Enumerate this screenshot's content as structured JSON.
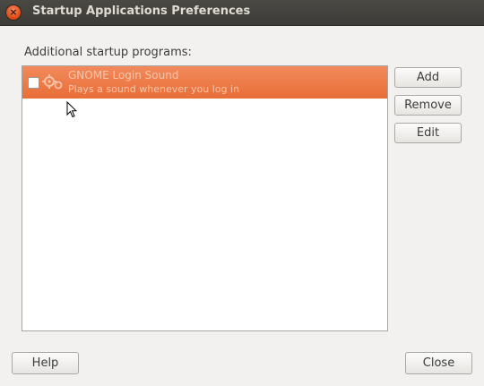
{
  "window": {
    "title": "Startup Applications Preferences",
    "close_icon": "close-icon"
  },
  "main": {
    "section_label": "Additional startup programs:",
    "programs": [
      {
        "name": "GNOME Login Sound",
        "description": "Plays a sound whenever you log in",
        "enabled": false,
        "selected": true,
        "icon": "gears-icon"
      }
    ]
  },
  "side_buttons": {
    "add": "Add",
    "remove": "Remove",
    "edit": "Edit"
  },
  "footer": {
    "help": "Help",
    "close": "Close"
  },
  "colors": {
    "selection": "#e9733f",
    "titlebar": "#3c3b37",
    "close_button": "#df4a16"
  }
}
